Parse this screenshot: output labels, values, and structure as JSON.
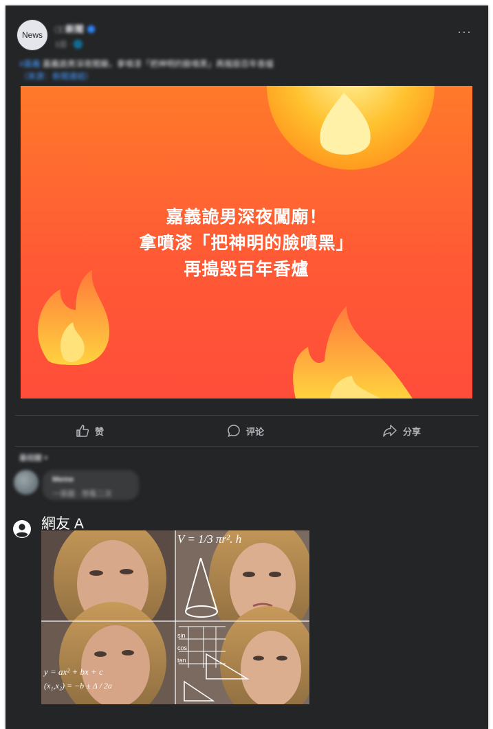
{
  "post": {
    "avatar_text": "News",
    "page_name": "□□新聞",
    "meta": "1日 · 🌐",
    "caption": "嘉義詭男深夜闖廟，拿噴漆「把神明的臉噴黑」再搗毀百年香爐",
    "caption_tag": "#嘉義",
    "caption_link": "（來源：新聞連結）",
    "menu_icon": "more-dots-icon"
  },
  "hero": {
    "line1": "嘉義詭男深夜闖廟！",
    "line2": "拿噴漆「把神明的臉噴黑」",
    "line3": "再搗毀百年香爐"
  },
  "actions": {
    "like": "赞",
    "comment": "评论",
    "share": "分享"
  },
  "comments": {
    "sort_label": "最相關 ▾",
    "blurred_name": "Meme",
    "blurred_text": "一張圖 · 想看二次",
    "user_name": "網友 A",
    "meme_formula_top": "V = 1/3 πr². h",
    "meme_formula_bottom": "y = ax² + bx + c",
    "meme_trig": [
      "sin",
      "cos",
      "tan"
    ]
  },
  "colors": {
    "card_bg": "#242526",
    "hero_orange": "#ff5a35",
    "text_primary": "#e4e6eb",
    "text_secondary": "#b0b3b8"
  }
}
